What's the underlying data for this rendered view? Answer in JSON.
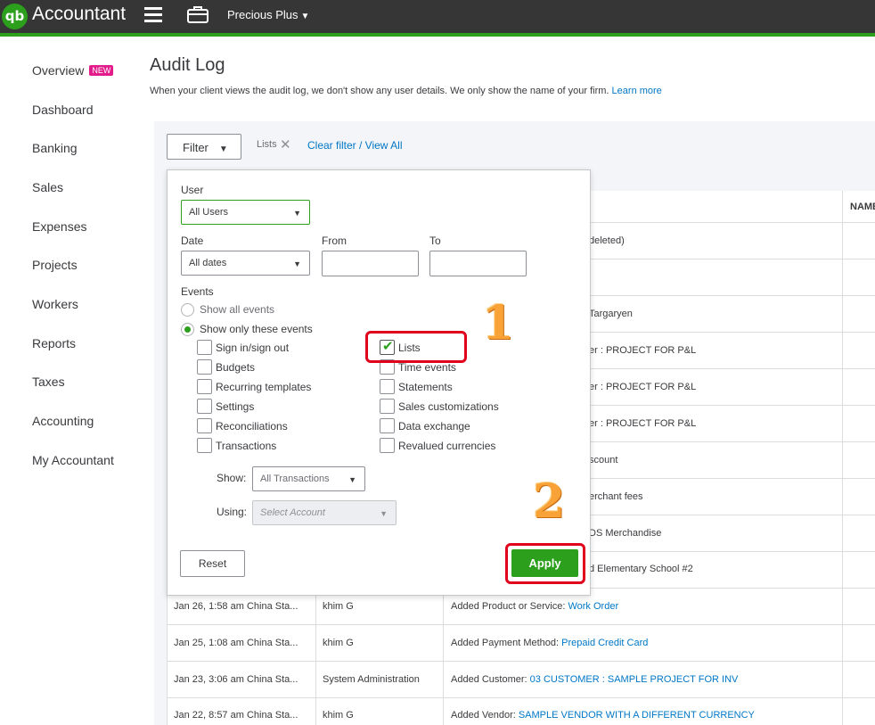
{
  "app": {
    "logo_text": "qb",
    "title": "Accountant",
    "company": "Precious Plus"
  },
  "sidebar": {
    "items": [
      {
        "label": "Overview",
        "badge": "NEW"
      },
      {
        "label": "Dashboard"
      },
      {
        "label": "Banking"
      },
      {
        "label": "Sales"
      },
      {
        "label": "Expenses"
      },
      {
        "label": "Projects"
      },
      {
        "label": "Workers"
      },
      {
        "label": "Reports"
      },
      {
        "label": "Taxes"
      },
      {
        "label": "Accounting"
      },
      {
        "label": "My Accountant"
      }
    ]
  },
  "page": {
    "title": "Audit Log",
    "description": "When your client views the audit log, we don't show any user details. We only show the name of your firm.",
    "learn_more": "Learn more"
  },
  "toolbar": {
    "filter_label": "Filter",
    "chip_label": "Lists",
    "clear_link": "Clear filter / View All"
  },
  "filter": {
    "user_label": "User",
    "user_value": "All Users",
    "date_label": "Date",
    "date_value": "All dates",
    "from_label": "From",
    "to_label": "To",
    "events_label": "Events",
    "radio_all": "Show all events",
    "radio_only": "Show only these events",
    "checkboxes_left": [
      "Sign in/sign out",
      "Budgets",
      "Recurring templates",
      "Settings",
      "Reconciliations",
      "Transactions"
    ],
    "checkboxes_right": [
      "Lists",
      "Time events",
      "Statements",
      "Sales customizations",
      "Data exchange",
      "Revalued currencies"
    ],
    "checked": [
      "Lists"
    ],
    "show_label": "Show:",
    "show_value": "All Transactions",
    "using_label": "Using:",
    "using_placeholder": "Select Account",
    "reset_label": "Reset",
    "apply_label": "Apply"
  },
  "annotations": {
    "step1": "1",
    "step2": "2"
  },
  "table": {
    "name_header": "NAME",
    "partial_rows": [
      "deleted)",
      "",
      "Targaryen",
      "er : PROJECT FOR P&L",
      "er : PROJECT FOR P&L",
      "er : PROJECT FOR P&L",
      "scount",
      "erchant fees",
      "DS Merchandise",
      "d Elementary School #2"
    ],
    "rows": [
      {
        "date": "Jan 26, 1:58 am China Sta...",
        "user": "khim G",
        "event": "Added Product or Service: ",
        "link": "Work Order"
      },
      {
        "date": "Jan 25, 1:08 am China Sta...",
        "user": "khim G",
        "event": "Added Payment Method: ",
        "link": "Prepaid Credit Card"
      },
      {
        "date": "Jan 23, 3:06 am China Sta...",
        "user": "System Administration",
        "event": "Added Customer: ",
        "link": "03 CUSTOMER : SAMPLE PROJECT FOR INV"
      },
      {
        "date": "Jan 22, 8:57 am China Sta...",
        "user": "khim G",
        "event": "Added Vendor: ",
        "link": "SAMPLE VENDOR WITH A DIFFERENT CURRENCY"
      }
    ]
  }
}
